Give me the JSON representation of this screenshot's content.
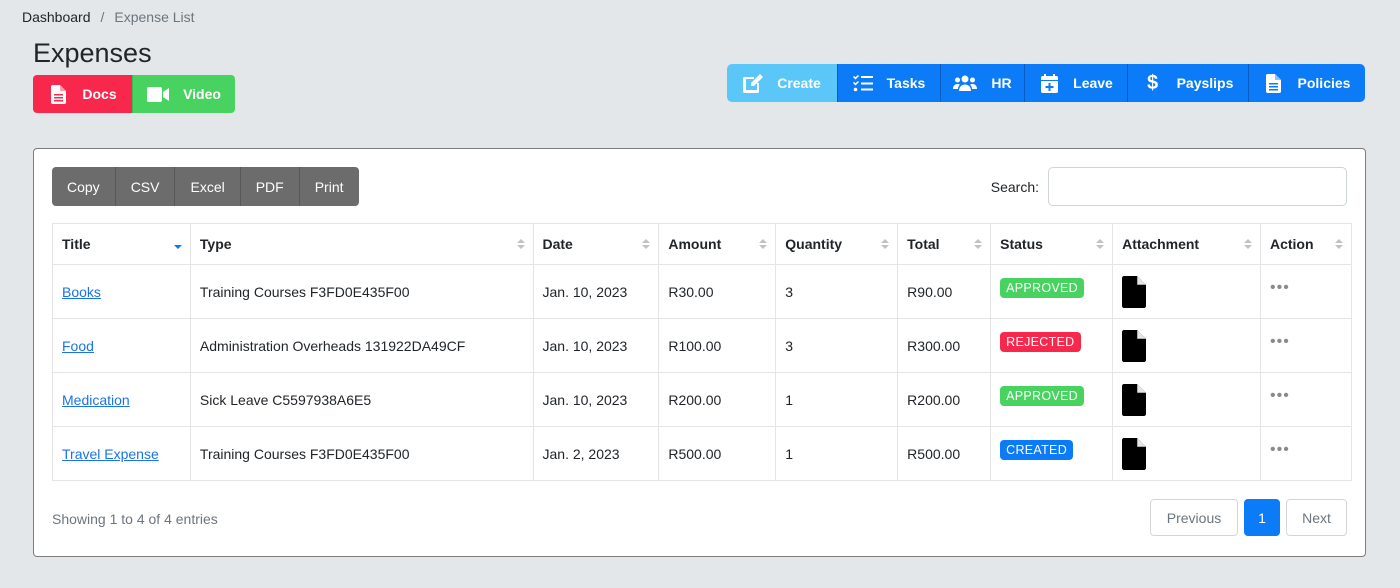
{
  "breadcrumb": {
    "items": [
      {
        "label": "Dashboard"
      },
      {
        "label": "Expense List"
      }
    ],
    "separator": "/"
  },
  "page_title": "Expenses",
  "help_buttons": {
    "docs": {
      "label": "Docs",
      "icon": "file-text-icon"
    },
    "video": {
      "label": "Video",
      "icon": "video-camera-icon"
    }
  },
  "nav_buttons": {
    "create": {
      "label": "Create",
      "icon": "edit-icon"
    },
    "tasks": {
      "label": "Tasks",
      "icon": "task-list-icon"
    },
    "hr": {
      "label": "HR",
      "icon": "users-icon"
    },
    "leave": {
      "label": "Leave",
      "icon": "calendar-plus-icon"
    },
    "payslips": {
      "label": "Payslips",
      "icon": "dollar-icon"
    },
    "policies": {
      "label": "Policies",
      "icon": "file-text-icon"
    }
  },
  "export_buttons": [
    "Copy",
    "CSV",
    "Excel",
    "PDF",
    "Print"
  ],
  "search": {
    "label": "Search:",
    "value": "",
    "placeholder": ""
  },
  "table": {
    "columns": [
      "Title",
      "Type",
      "Date",
      "Amount",
      "Quantity",
      "Total",
      "Status",
      "Attachment",
      "Action"
    ],
    "sorted_column": "Title",
    "sort_direction": "descending",
    "rows": [
      {
        "title": "Books",
        "type": "Training Courses F3FD0E435F00",
        "date": "Jan. 10, 2023",
        "amount": "R30.00",
        "quantity": "3",
        "total": "R90.00",
        "status": "APPROVED",
        "action": "•••"
      },
      {
        "title": "Food",
        "type": "Administration Overheads 131922DA49CF",
        "date": "Jan. 10, 2023",
        "amount": "R100.00",
        "quantity": "3",
        "total": "R300.00",
        "status": "REJECTED",
        "action": "•••"
      },
      {
        "title": "Medication",
        "type": "Sick Leave C5597938A6E5",
        "date": "Jan. 10, 2023",
        "amount": "R200.00",
        "quantity": "1",
        "total": "R200.00",
        "status": "APPROVED",
        "action": "•••"
      },
      {
        "title": "Travel Expense",
        "type": "Training Courses F3FD0E435F00",
        "date": "Jan. 2, 2023",
        "amount": "R500.00",
        "quantity": "1",
        "total": "R500.00",
        "status": "CREATED",
        "action": "•••"
      }
    ]
  },
  "footer": {
    "info": "Showing 1 to 4 of 4 entries",
    "pagination": {
      "previous": "Previous",
      "current": "1",
      "next": "Next"
    }
  },
  "colors": {
    "approved": "#48d360",
    "rejected": "#f8284d",
    "created": "#0b7bf7",
    "primary": "#0b7bf7",
    "info": "#5bc6f8",
    "secondary": "#6c6c6c"
  }
}
